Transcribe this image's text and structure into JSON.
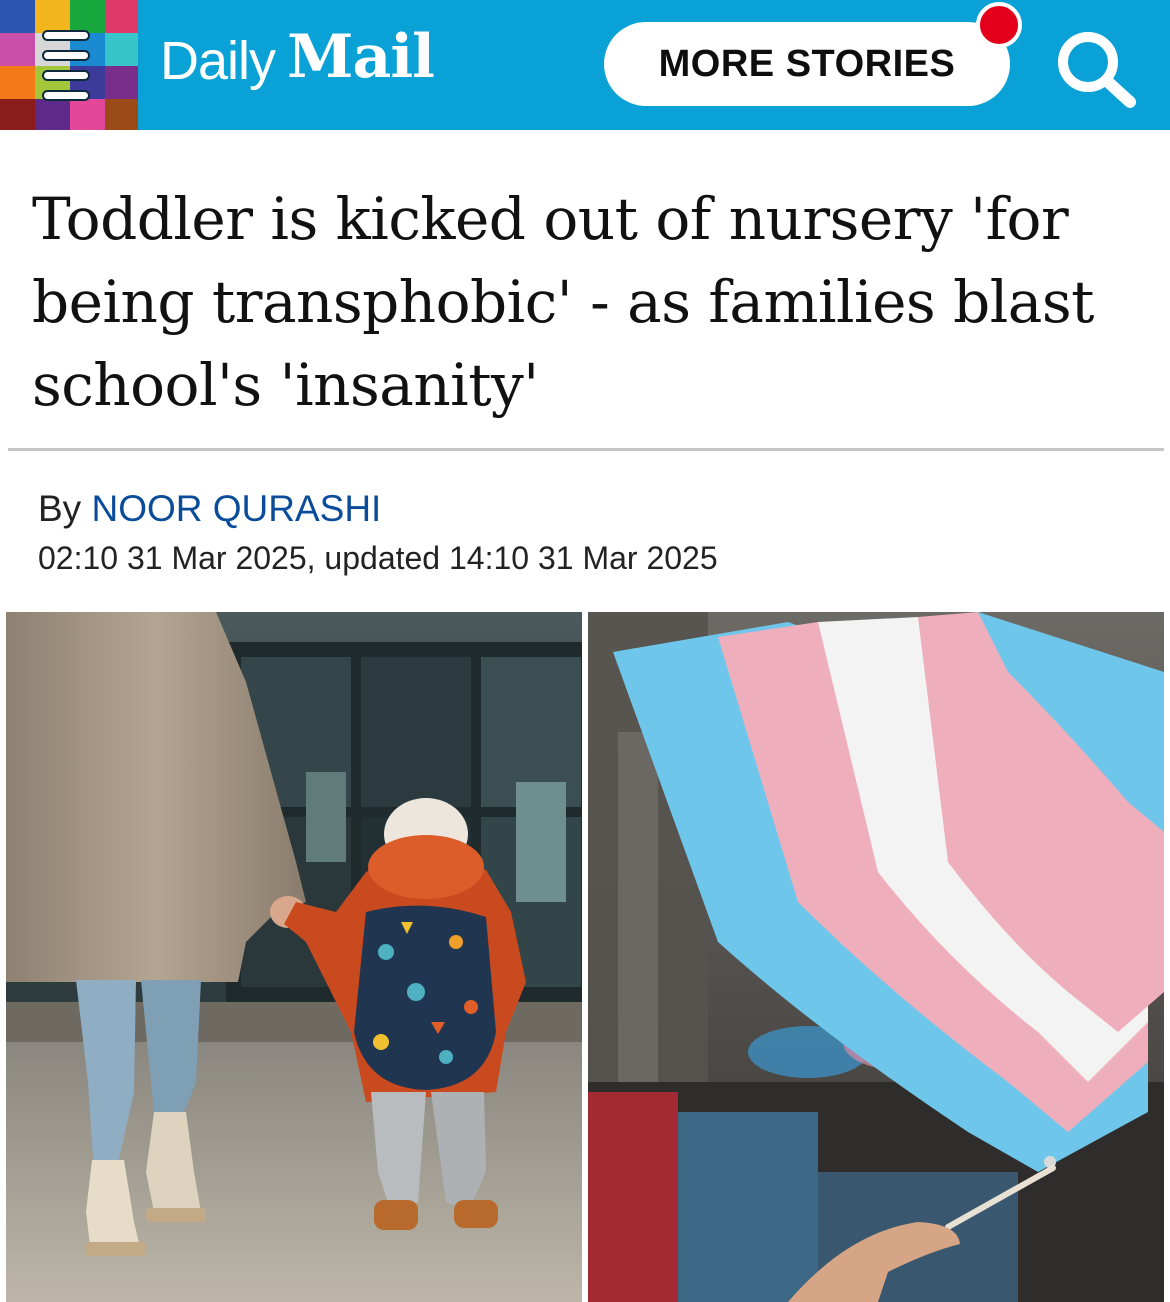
{
  "header": {
    "brand_light": "Daily",
    "brand_bold": "Mail",
    "more_stories_label": "MORE STORIES",
    "brand_color": "#0aa2d6",
    "notification_color": "#e4001b"
  },
  "article": {
    "headline": "Toddler is kicked out of nursery 'for being transphobic' - as families blast school's 'insanity'",
    "byline_prefix": "By",
    "author": "NOOR QURASHI",
    "timestamp": "02:10 31 Mar 2025, updated 14:10 31 Mar 2025"
  },
  "icons": {
    "menu": "hamburger-menu-icon",
    "search": "search-icon"
  }
}
